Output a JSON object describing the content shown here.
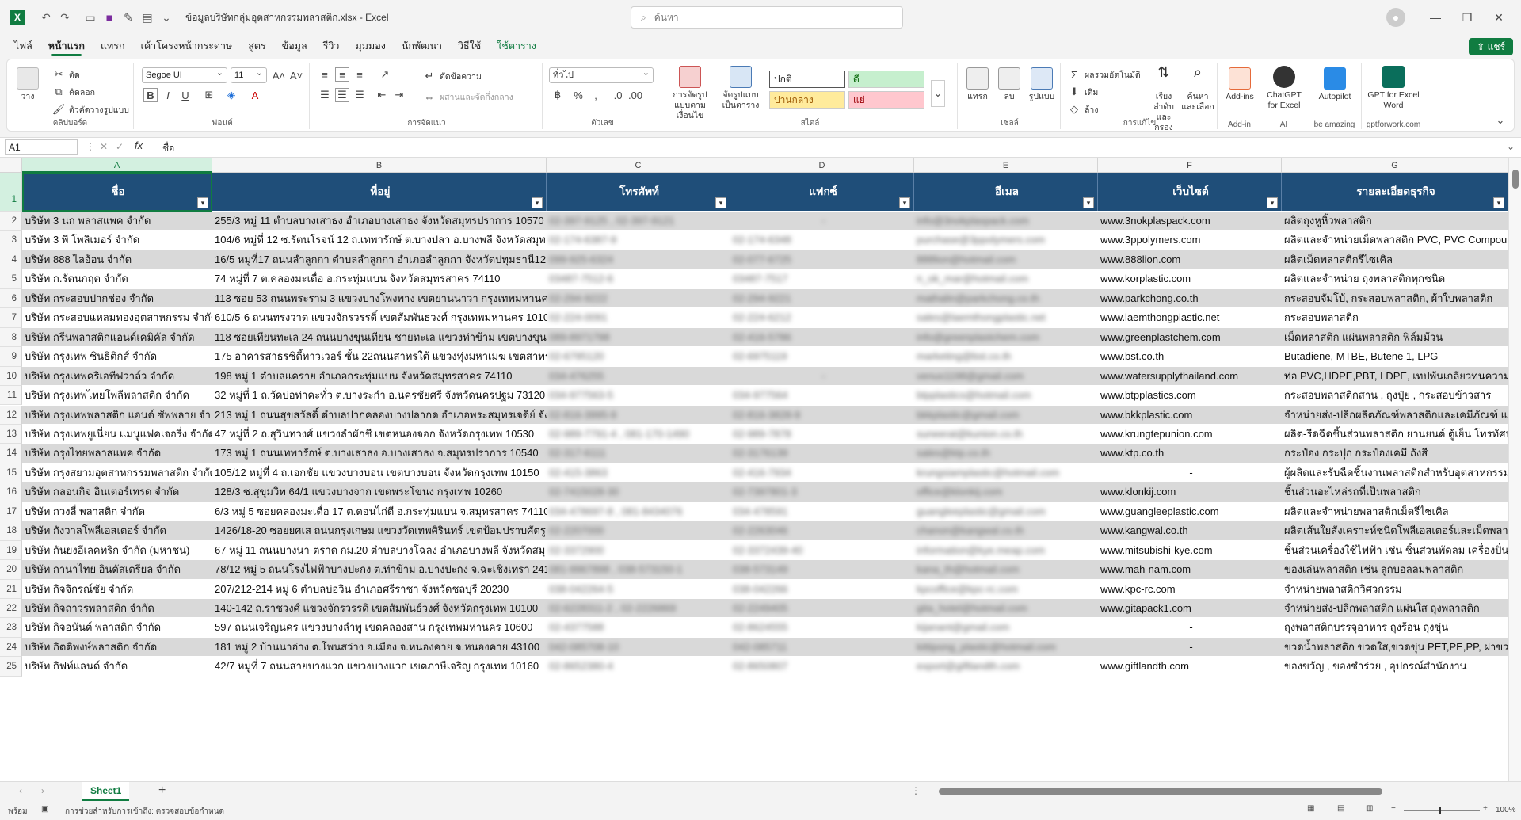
{
  "app": {
    "title": "ข้อมูลบริษัทกลุ่มอุตสาหกรรมพลาสติก.xlsx  -  Excel",
    "search_placeholder": "ค้นหา",
    "share_label": "แชร์"
  },
  "menu": [
    "ไฟล์",
    "หน้าแรก",
    "แทรก",
    "เค้าโครงหน้ากระดาษ",
    "สูตร",
    "ข้อมูล",
    "รีวิว",
    "มุมมอง",
    "นักพัฒนา",
    "วิธีใช้",
    "ใช้ตาราง"
  ],
  "ribbon": {
    "clipboard": {
      "paste": "วาง",
      "cut": "ตัด",
      "copy": "คัดลอก",
      "format_painter": "ตัวคัดวางรูปแบบ",
      "label": "คลิปบอร์ด"
    },
    "font": {
      "name": "Segoe UI",
      "size": "11",
      "label": "ฟอนต์"
    },
    "alignment": {
      "wrap": "ตัดข้อความ",
      "merge": "ผสานและจัดกึ่งกลาง",
      "label": "การจัดแนว"
    },
    "number": {
      "format": "ทั่วไป",
      "label": "ตัวเลข"
    },
    "styles": {
      "cond_format": "การจัดรูปแบบตามเงื่อนไข",
      "format_table": "จัดรูปแบบเป็นตาราง",
      "normal": "ปกติ",
      "good": "ดี",
      "neutral": "ปานกลาง",
      "bad": "แย่",
      "label": "สไตล์"
    },
    "cells": {
      "insert": "แทรก",
      "delete": "ลบ",
      "format": "รูปแบบ",
      "label": "เซลล์"
    },
    "editing": {
      "autosum": "ผลรวมอัตโนมัติ",
      "fill": "เติม",
      "clear": "ล้าง",
      "sort": "เรียงลำดับและกรอง",
      "find": "ค้นหาและเลือก",
      "label": "การแก้ไข"
    },
    "addins": {
      "addins": "Add-ins",
      "label": "Add-in"
    },
    "ai": {
      "chatgpt": "ChatGPT for Excel",
      "label": "AI"
    },
    "autopilot": {
      "name": "Autopilot",
      "label": "be amazing"
    },
    "gptword": {
      "name": "GPT for Excel Word",
      "label": "gptforwork.com"
    }
  },
  "formula_bar": {
    "cell": "A1",
    "content": "ชื่อ",
    "fx": "fx"
  },
  "columns": [
    "A",
    "B",
    "C",
    "D",
    "E",
    "F",
    "G"
  ],
  "headers": [
    "ชื่อ",
    "ที่อยู่",
    "โทรศัพท์",
    "แฟกซ์",
    "อีเมล",
    "เว็บไซต์",
    "รายละเอียดธุรกิจ"
  ],
  "rows": [
    {
      "n": "2",
      "name": "บริษัท 3 นก พลาสแพค จำกัด",
      "addr": "255/3 หมู่ 11 ตำบลบางเสาธง อำเภอบางเสาธง จังหวัดสมุทรปราการ 10570",
      "tel": "02-397-9125 , 02-397-9121",
      "fax": "-",
      "email": "info@3nokplaspack.com",
      "web": "www.3nokplaspack.com",
      "biz": "ผลิตถุงหูหิ้วพลาสติก"
    },
    {
      "n": "3",
      "name": "บริษัท 3 พี โพลิเมอร์ จำกัด",
      "addr": "104/6 หมู่ที่ 12 ซ.รัตนโรจน์ 12 ถ.เทพารักษ์ ต.บางปลา อ.บางพลี จังหวัดสมุท",
      "tel": "02-174-6387-9",
      "fax": "02-174-6348",
      "email": "purchase@3ppolymers.com",
      "web": "www.3ppolymers.com",
      "biz": "ผลิตและจำหน่ายเม็ดพลาสติก PVC, PVC Compound"
    },
    {
      "n": "4",
      "name": "บริษัท 888 ไลอ้อน จำกัด",
      "addr": "16/5 หมู่ที่17 ถนนลำลูกกา ตำบลลำลูกกา อำเภอลำลูกกา จังหวัดปทุมธานี12",
      "tel": "099-925-6324",
      "fax": "02-077-6725",
      "email": "888lion@hotmail.com",
      "web": "www.888lion.com",
      "biz": "ผลิตเม็ดพลาสติกรีไซเคิล"
    },
    {
      "n": "5",
      "name": "บริษัท ก.รัตนกฤต จำกัด",
      "addr": "74 หมู่ที่ 7 ต.คลองมะเดื่อ อ.กระทุ่มแบน จังหวัดสมุทรสาคร 74110",
      "tel": "03487-7512-6",
      "fax": "03487-7517",
      "email": "n_ok_mar@hotmail.com",
      "web": "www.korplastic.com",
      "biz": "ผลิตและจำหน่าย ถุงพลาสติกทุกชนิด"
    },
    {
      "n": "6",
      "name": "บริษัท กระสอบปากช่อง จำกัด",
      "addr": "113 ซอย 53 ถนนพระราม 3 แขวงบางโพงพาง เขตยานนาวา กรุงเทพมหานคร",
      "tel": "02-294-9222",
      "fax": "02-294-9221",
      "email": "mathalin@parkchong.co.th",
      "web": "www.parkchong.co.th",
      "biz": "กระสอบจัมโบ้, กระสอบพลาสติก, ผ้าใบพลาสติก"
    },
    {
      "n": "7",
      "name": "บริษัท กระสอบแหลมทองอุตสาหกรรม จำกัด",
      "addr": "610/5-6 ถนนทรงวาด แขวงจักรวรรดิ์ เขตสัมพันธวงศ์ กรุงเทพมหานคร 1010",
      "tel": "02-224-0091",
      "fax": "02-224-6212",
      "email": "sales@laemthongplastic.net",
      "web": "www.laemthongplastic.net",
      "biz": "กระสอบพลาสติก"
    },
    {
      "n": "8",
      "name": "บริษัท กรีนพลาสติกแอนด์เคมิคัล จำกัด",
      "addr": "118 ซอยเทียนทะเล 24 ถนนบางขุนเทียน-ชายทะเล แขวงท่าข้าม เขตบางขุน",
      "tel": "089-8971798",
      "fax": "02-416-5786",
      "email": "info@greenplastchem.com",
      "web": "www.greenplastchem.com",
      "biz": "เม็ดพลาสติก แผ่นพลาสติก ฟิล์มม้วน"
    },
    {
      "n": "9",
      "name": "บริษัท กรุงเทพ ซินธิติกส์ จำกัด",
      "addr": "175 อาคารสาธรซิตี้ทาวเวอร์ ชั้น 22ถนนสาทรใต้ แขวงทุ่งมหาเมฆ เขตสาทร",
      "tel": "02-6795120",
      "fax": "02-6975119",
      "email": "marketing@bst.co.th",
      "web": "www.bst.co.th",
      "biz": "Butadiene, MTBE, Butene 1, LPG"
    },
    {
      "n": "10",
      "name": "บริษัท กรุงเทพคริเอทีฟวาล์ว จำกัด",
      "addr": "198 หมู่ 1 ตำบลแคราย อำเภอกระทุ่มแบน จังหวัดสมุทรสาคร 74110",
      "tel": "034-476255",
      "fax": "-",
      "email": "venus1198@gmail.com",
      "web": "www.watersupplythailand.com",
      "biz": "ท่อ PVC,HDPE,PBT, LDPE, เทปพันเกลียวทนความร้อน"
    },
    {
      "n": "11",
      "name": "บริษัท กรุงเทพไทยโพลีพลาสติก จำกัด",
      "addr": "32 หมู่ที่ 1 ถ.วัดบ่อท่าคะทั่ว ต.บางระกำ อ.นครชัยศรี จังหวัดนครปฐม 73120",
      "tel": "034-977563-5",
      "fax": "034-977564",
      "email": "btpplastics@hotmail.com",
      "web": "www.btpplastics.com",
      "biz": "กระสอบพลาสติกสาน , ถุงปุ๋ย , กระสอบข้าวสาร"
    },
    {
      "n": "12",
      "name": "บริษัท กรุงเทพพลาสติก แอนด์ ซัพพลาย จำกัด",
      "addr": "213 หมู่ 1 ถนนสุขสวัสดิ์ ตำบลปากคลองบางปลากด อำเภอพระสมุทรเจดีย์ จัง",
      "tel": "02-816-3995-9",
      "fax": "02-816-3828-9",
      "email": "bkkplastic@gmail.com",
      "web": "www.bkkplastic.com",
      "biz": "จำหน่ายส่ง-ปลีกผลิตภัณฑ์พลาสติกและเคมีภัณฑ์ แ"
    },
    {
      "n": "13",
      "name": "บริษัท กรุงเทพยูเนี่ยน แมนูแฟคเจอริ่ง จำกัด",
      "addr": "47 หมู่ที่ 2 ถ.สุวินทวงศ์ แขวงลำผักชี เขตหนองจอก จังหวัดกรุงเทพ 10530",
      "tel": "02-989-7791-4 , 081-170-1490",
      "fax": "02-989-7878",
      "email": "suneerat@kunion.co.th",
      "web": "www.krungtepunion.com",
      "biz": "ผลิต-รีดฉีดชิ้นส่วนพลาสติก ยานยนต์ ตู้เย็น โทรทัศน์"
    },
    {
      "n": "14",
      "name": "บริษัท กรุงไทยพลาสแพค จำกัด",
      "addr": "173 หมู่ 1 ถนนเทพารักษ์ ต.บางเสาธง อ.บางเสาธง จ.สมุทรปราการ 10540",
      "tel": "02-317-6111",
      "fax": "02-3176139",
      "email": "sales@ktp.co.th",
      "web": "www.ktp.co.th",
      "biz": "กระป๋อง กระปุก กระป๋องเคมี ถังสี"
    },
    {
      "n": "15",
      "name": "บริษัท กรุงสยามอุตสาหกรรมพลาสติก จำกัด",
      "addr": "105/12 หมู่ที่ 4 ถ.เอกชัย แขวงบางบอน เขตบางบอน จังหวัดกรุงเทพ 10150",
      "tel": "02-415-3863",
      "fax": "02-416-7934",
      "email": "krungsiamplastic@hotmail.com",
      "web": "-",
      "biz": "ผู้ผลิตและรับฉีดชิ้นงานพลาสติกสำหรับอุตสาหกรรม"
    },
    {
      "n": "16",
      "name": "บริษัท กลอนกิจ อินเตอร์เทรด จำกัด",
      "addr": "128/3 ซ.สุขุมวิท 64/1 แขวงบางจาก เขตพระโขนง กรุงเทพ 10260",
      "tel": "02-7415028-30",
      "fax": "02-7397801-3",
      "email": "office@klonkij.com",
      "web": "www.klonkij.com",
      "biz": "ชิ้นส่วนอะไหล่รถที่เป็นพลาสติก"
    },
    {
      "n": "17",
      "name": "บริษัท กวงลี่ พลาสติก จำกัด",
      "addr": "6/3 หมู่ 5 ซอยคลองมะเดื่อ 17 ต.ดอนไก่ดี อ.กระทุ่มแบน จ.สมุทรสาคร 74110",
      "tel": "034-478697-8 , 081-8434076",
      "fax": "034-478591",
      "email": "guangleeplastic@gmail.com",
      "web": "www.guangleeplastic.com",
      "biz": "ผลิตและจำหน่ายพลาสติกเม็ดรีไซเคิล"
    },
    {
      "n": "18",
      "name": "บริษัท กังวาลโพลีเอสเตอร์ จำกัด",
      "addr": "1426/18-20 ซอยยศเส ถนนกรุงเกษม แขวงวัดเทพศิรินทร์ เขตป้อมปราบศัตรู",
      "tel": "02-2207000",
      "fax": "02-2263046",
      "email": "chanon@kangwal.co.th",
      "web": "www.kangwal.co.th",
      "biz": "ผลิตเส้นใยสังเคราะห์ชนิดโพลีเอสเตอร์และเม็ดพลาส"
    },
    {
      "n": "19",
      "name": "บริษัท กันยงอีเลคทริก จำกัด (มหาชน)",
      "addr": "67 หมู่ 11 ถนนบางนา-ตราด กม.20 ตำบลบางโฉลง อำเภอบางพลี จังหวัดสมุ",
      "tel": "02-3372900",
      "fax": "02-3372439-40",
      "email": "information@kye.meap.com",
      "web": "www.mitsubishi-kye.com",
      "biz": "ชิ้นส่วนเครื่องใช้ไฟฟ้า เช่น ชิ้นส่วนพัดลม เครื่องปั่นน้ำ"
    },
    {
      "n": "20",
      "name": "บริษัท กานาไทย อินดัสเตรียล จำกัด",
      "addr": "78/12 หมู่ 5 ถนนโรงไฟฟ้าบางปะกง ต.ท่าข้าม อ.บางปะกง จ.ฉะเชิงเทรา 241",
      "tel": "081-9967898 , 038-573150-1",
      "fax": "038-573149",
      "email": "kana_th@hotmail.com",
      "web": "www.mah-nam.com",
      "biz": "ของเล่นพลาสติก เช่น ลูกบอลลมพลาสติก"
    },
    {
      "n": "21",
      "name": "บริษัท กิจจิกรณ์ชัย จำกัด",
      "addr": "207/212-214 หมู่ 6 ตำบลบ่อวิน อำเภอศรีราชา จังหวัดชลบุรี 20230",
      "tel": "038-042264-5",
      "fax": "038-042266",
      "email": "kpcoffice@kpc-rc.com",
      "web": "www.kpc-rc.com",
      "biz": "จำหน่ายพลาสติกวิศวกรรม"
    },
    {
      "n": "22",
      "name": "บริษัท กิจถาวรพลาสติก จำกัด",
      "addr": "140-142 ถ.ราชวงศ์ แขวงจักรวรรดิ เขตสัมพันธ์วงศ์ จังหวัดกรุงเทพ 10100",
      "tel": "02-6228311-2 , 02-2226869",
      "fax": "02-2249405",
      "email": "gita_hotel@hotmail.com",
      "web": "www.gitapack1.com",
      "biz": "จำหน่ายส่ง-ปลีกพลาสติก แผ่นใส ถุงพลาสติก"
    },
    {
      "n": "23",
      "name": "บริษัท กิจอนันต์ พลาสติก จำกัด",
      "addr": "597 ถนนเจริญนคร แขวงบางลำพู เขตคลองสาน กรุงเทพมหานคร 10600",
      "tel": "02-4377588",
      "fax": "02-8624555",
      "email": "kijanant@gmail.com",
      "web": "-",
      "biz": "ถุงพลาสติกบรรจุอาหาร ถุงร้อน ถุงขุ่น"
    },
    {
      "n": "24",
      "name": "บริษัท กิตติพงษ์พลาสติก จำกัด",
      "addr": "181 หมู่ 2 บ้านนาอ่าง ต.โพนสว่าง อ.เมือง จ.หนองคาย จ.หนองคาย 43100",
      "tel": "042-085708-10",
      "fax": "042-085711",
      "email": "kittipong_plastic@hotmail.com",
      "web": "-",
      "biz": "ขวดน้ำพลาสติก ขวดใส,ขวดขุ่น PET,PE,PP, ฝาขวดน้ำ"
    },
    {
      "n": "25",
      "name": "บริษัท กิฟท์แลนด์ จำกัด",
      "addr": "42/7 หมู่ที่ 7 ถนนสายบางแวก แขวงบางแวก เขตภาษีเจริญ กรุงเทพ 10160",
      "tel": "02-8652380-4",
      "fax": "02-8650807",
      "email": "export@giftlandth.com",
      "web": "www.giftlandth.com",
      "biz": "ของขวัญ , ของชำร่วย , อุปกรณ์สำนักงาน"
    }
  ],
  "sheet_tab": "Sheet1",
  "status": {
    "ready": "พร้อม",
    "accessibility": "การช่วยสำหรับการเข้าถึง: ตรวจสอบข้อกำหนด",
    "zoom": "100%"
  }
}
